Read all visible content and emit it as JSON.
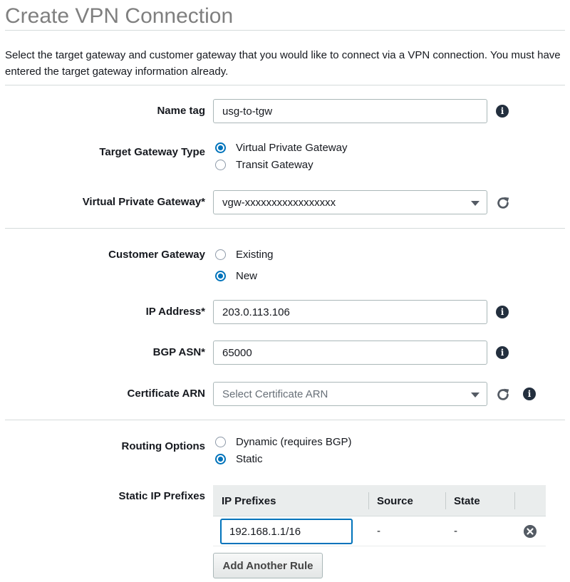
{
  "page": {
    "title": "Create VPN Connection",
    "intro": "Select the target gateway and customer gateway that you would like to connect via a VPN connection. You must have entered the target gateway information already."
  },
  "name_tag": {
    "label": "Name tag",
    "value": "usg-to-tgw"
  },
  "target_gateway_type": {
    "label": "Target Gateway Type",
    "options": [
      {
        "label": "Virtual Private Gateway",
        "checked": true
      },
      {
        "label": "Transit Gateway",
        "checked": false
      }
    ]
  },
  "virtual_private_gateway": {
    "label": "Virtual Private Gateway*",
    "value": "vgw-xxxxxxxxxxxxxxxxx"
  },
  "customer_gateway": {
    "label": "Customer Gateway",
    "options": [
      {
        "label": "Existing",
        "checked": false
      },
      {
        "label": "New",
        "checked": true
      }
    ]
  },
  "ip_address": {
    "label": "IP Address*",
    "value": "203.0.113.106"
  },
  "bgp_asn": {
    "label": "BGP ASN*",
    "value": "65000"
  },
  "certificate_arn": {
    "label": "Certificate ARN",
    "placeholder": "Select Certificate ARN"
  },
  "routing_options": {
    "label": "Routing Options",
    "options": [
      {
        "label": "Dynamic (requires BGP)",
        "checked": false
      },
      {
        "label": "Static",
        "checked": true
      }
    ]
  },
  "static_ip_prefixes": {
    "label": "Static IP Prefixes",
    "columns": [
      "IP Prefixes",
      "Source",
      "State"
    ],
    "rows": [
      {
        "prefix": "192.168.1.1/16",
        "source": "-",
        "state": "-"
      }
    ],
    "add_button": "Add Another Rule"
  },
  "icons": {
    "info": "info-icon",
    "refresh": "refresh-icon",
    "dropdown": "chevron-down-icon",
    "remove": "remove-icon"
  },
  "colors": {
    "accent": "#0073bb",
    "icon_dark": "#232f3e",
    "title_gray": "#7f7f7f"
  }
}
